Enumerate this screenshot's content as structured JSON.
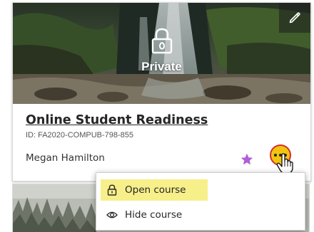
{
  "course_card": {
    "banner_status": "Private",
    "title": "Online Student Readiness",
    "course_id": "ID: FA2020-COMPUB-798-855",
    "instructor": "Megan Hamilton",
    "favorite": true,
    "colors": {
      "favorite_star": "#b05fd6",
      "more_button_fill": "#f2c40f",
      "more_button_ring": "#d32f2f",
      "highlight": "#f7ef8a"
    }
  },
  "icons": {
    "edit": "pencil-icon",
    "lock": "lock-icon",
    "star": "star-icon",
    "more": "more-options-icon",
    "cursor": "hand-pointer-icon"
  },
  "course_menu": {
    "items": [
      {
        "label": "Open course",
        "icon": "lock-icon",
        "highlighted": true
      },
      {
        "label": "Hide course",
        "icon": "eye-icon",
        "highlighted": false
      }
    ]
  }
}
